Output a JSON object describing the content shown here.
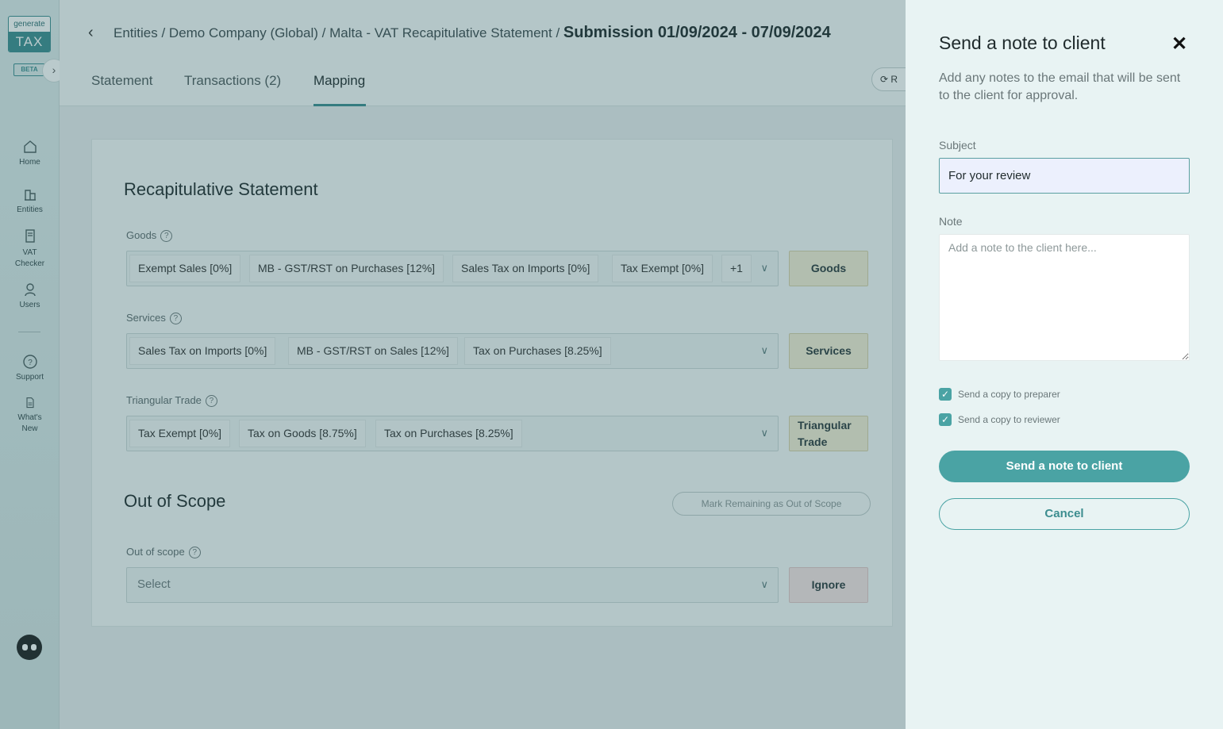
{
  "sidebar": {
    "logo_top": "generate",
    "logo_bottom": "TAX",
    "beta": "BETA",
    "items": [
      {
        "label": "Home",
        "icon": "home-icon"
      },
      {
        "label": "Entities",
        "icon": "building-icon"
      },
      {
        "label": "VAT Checker",
        "icon": "document-icon"
      },
      {
        "label": "Users",
        "icon": "user-icon"
      },
      {
        "label": "Support",
        "icon": "help-icon"
      },
      {
        "label": "What's New",
        "icon": "news-icon"
      }
    ]
  },
  "header": {
    "breadcrumb": "Entities / Demo Company (Global) / Malta - VAT Recapitulative Statement /",
    "current": "Submission 01/09/2024 - 07/09/2024",
    "tabs": [
      "Statement",
      "Transactions (2)",
      "Mapping"
    ],
    "active_tab": "Mapping",
    "refresh_label": "R"
  },
  "mapping": {
    "section_title": "Recapitulative Statement",
    "rows": [
      {
        "label": "Goods",
        "chips": [
          "Exempt Sales [0%]",
          "MB - GST/RST on Purchases [12%]",
          "Sales Tax on Imports [0%]",
          "Tax Exempt [0%]",
          "+1"
        ],
        "button": "Goods"
      },
      {
        "label": "Services",
        "chips": [
          "Sales Tax on Imports [0%]",
          "MB - GST/RST on Sales [12%]",
          "Tax on Purchases [8.25%]"
        ],
        "button": "Services"
      },
      {
        "label": "Triangular Trade",
        "chips": [
          "Tax Exempt [0%]",
          "Tax on Goods [8.75%]",
          "Tax on Purchases [8.25%]"
        ],
        "button_line1": "Triangular",
        "button_line2": "Trade"
      }
    ],
    "out_of_scope_title": "Out of Scope",
    "mark_remaining": "Mark Remaining as Out of Scope",
    "out_of_scope_label": "Out of scope",
    "select_placeholder": "Select",
    "ignore": "Ignore"
  },
  "drawer": {
    "title": "Send a note to client",
    "description": "Add any notes to the email that will be sent to the client for approval.",
    "subject_label": "Subject",
    "subject_value": "For your review",
    "note_label": "Note",
    "note_placeholder": "Add a note to the client here...",
    "copy_preparer": "Send a copy to preparer",
    "copy_reviewer": "Send a copy to reviewer",
    "send_button": "Send a note to client",
    "cancel_button": "Cancel"
  }
}
